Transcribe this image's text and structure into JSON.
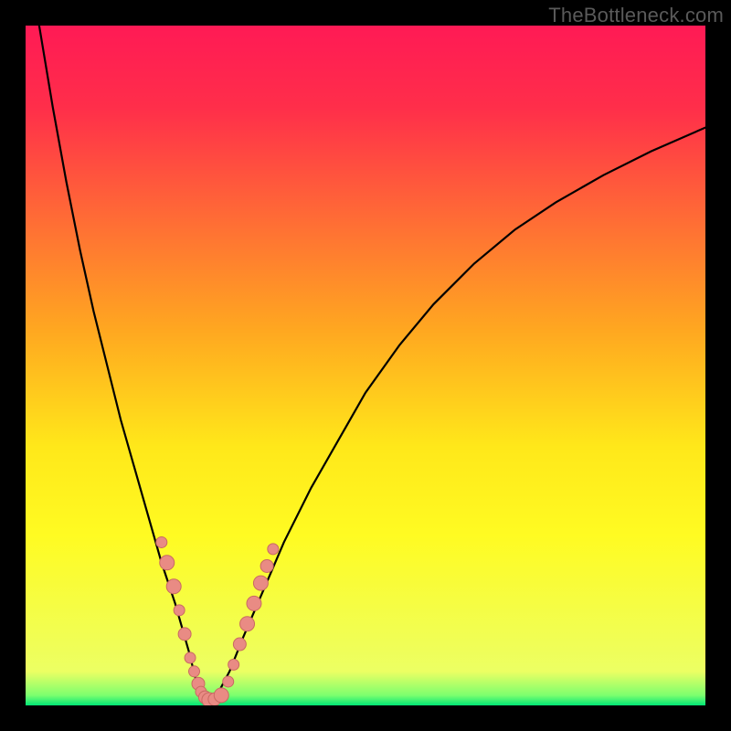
{
  "watermark": "TheBottleneck.com",
  "chart_data": {
    "type": "line",
    "title": "",
    "xlabel": "",
    "ylabel": "",
    "xlim": [
      0,
      100
    ],
    "ylim": [
      0,
      100
    ],
    "grid": false,
    "legend": false,
    "background_gradient_stops": [
      {
        "offset": 0.0,
        "color": "#ff1a55"
      },
      {
        "offset": 0.12,
        "color": "#ff2e4a"
      },
      {
        "offset": 0.28,
        "color": "#ff6a36"
      },
      {
        "offset": 0.45,
        "color": "#ffa820"
      },
      {
        "offset": 0.62,
        "color": "#ffe81a"
      },
      {
        "offset": 0.75,
        "color": "#fffb22"
      },
      {
        "offset": 0.95,
        "color": "#ecff63"
      },
      {
        "offset": 0.985,
        "color": "#7dff6e"
      },
      {
        "offset": 1.0,
        "color": "#00e676"
      }
    ],
    "series": [
      {
        "name": "left-curve",
        "stroke": "#000000",
        "stroke_width": 2.2,
        "x": [
          2,
          4,
          6,
          8,
          10,
          12,
          14,
          16,
          18,
          20,
          22,
          24,
          25,
          26,
          27
        ],
        "y": [
          100,
          88,
          77,
          67,
          58,
          50,
          42,
          35,
          28,
          21,
          15,
          8,
          4,
          1.5,
          0
        ]
      },
      {
        "name": "right-curve",
        "stroke": "#000000",
        "stroke_width": 2.2,
        "x": [
          27,
          28,
          30,
          32,
          35,
          38,
          42,
          46,
          50,
          55,
          60,
          66,
          72,
          78,
          85,
          92,
          100
        ],
        "y": [
          0,
          1.2,
          5,
          10,
          17,
          24,
          32,
          39,
          46,
          53,
          59,
          65,
          70,
          74,
          78,
          81.5,
          85
        ]
      }
    ],
    "markers": [
      {
        "name": "valley-dots",
        "color": "#e98b84",
        "stroke": "#c96a62",
        "points": [
          {
            "x": 20.0,
            "y": 24.0,
            "r": 6
          },
          {
            "x": 20.8,
            "y": 21.0,
            "r": 8
          },
          {
            "x": 21.8,
            "y": 17.5,
            "r": 8
          },
          {
            "x": 22.6,
            "y": 14.0,
            "r": 6
          },
          {
            "x": 23.4,
            "y": 10.5,
            "r": 7
          },
          {
            "x": 24.2,
            "y": 7.0,
            "r": 6
          },
          {
            "x": 24.8,
            "y": 5.0,
            "r": 6
          },
          {
            "x": 25.4,
            "y": 3.2,
            "r": 7
          },
          {
            "x": 25.8,
            "y": 2.0,
            "r": 6
          },
          {
            "x": 26.4,
            "y": 1.2,
            "r": 7
          },
          {
            "x": 27.0,
            "y": 0.8,
            "r": 8
          },
          {
            "x": 27.8,
            "y": 0.9,
            "r": 7
          },
          {
            "x": 28.8,
            "y": 1.5,
            "r": 8
          },
          {
            "x": 29.8,
            "y": 3.5,
            "r": 6
          },
          {
            "x": 30.6,
            "y": 6.0,
            "r": 6
          },
          {
            "x": 31.5,
            "y": 9.0,
            "r": 7
          },
          {
            "x": 32.6,
            "y": 12.0,
            "r": 8
          },
          {
            "x": 33.6,
            "y": 15.0,
            "r": 8
          },
          {
            "x": 34.6,
            "y": 18.0,
            "r": 8
          },
          {
            "x": 35.5,
            "y": 20.5,
            "r": 7
          },
          {
            "x": 36.4,
            "y": 23.0,
            "r": 6
          }
        ]
      }
    ]
  }
}
